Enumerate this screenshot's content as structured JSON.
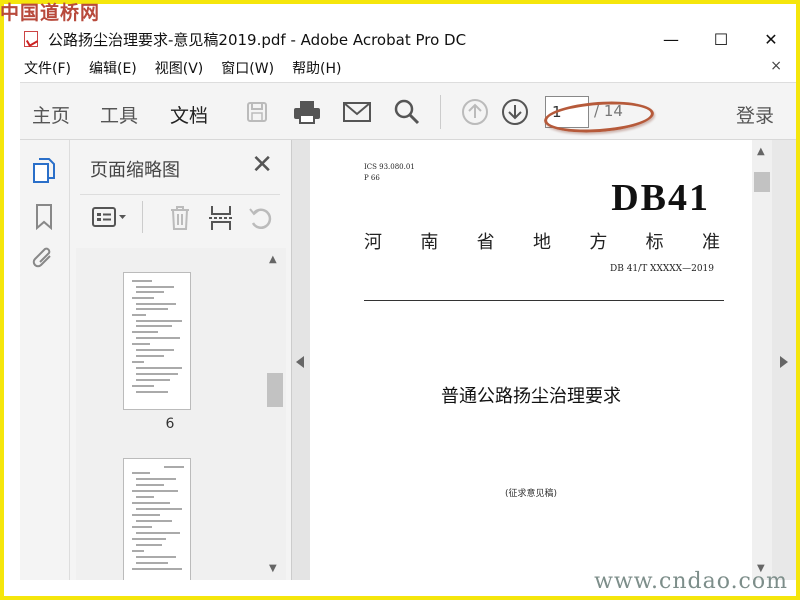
{
  "watermark": {
    "top": "中国道桥网",
    "bottom": "www.cndao.com"
  },
  "window": {
    "title": "公路扬尘治理要求-意见稿2019.pdf - Adobe Acrobat Pro DC"
  },
  "window_buttons": {
    "minimize": "—",
    "maximize": "☐",
    "close": "✕"
  },
  "menu": {
    "items": [
      {
        "label": "文件(F)"
      },
      {
        "label": "编辑(E)"
      },
      {
        "label": "视图(V)"
      },
      {
        "label": "窗口(W)"
      },
      {
        "label": "帮助(H)"
      }
    ],
    "close": "×"
  },
  "toolbar": {
    "tabs": [
      {
        "label": "主页"
      },
      {
        "label": "工具"
      },
      {
        "label": "文档"
      }
    ],
    "active_tab": "文档",
    "page_current": "1",
    "page_total": "/ 14",
    "login": "登录",
    "icons": [
      "save-icon",
      "print-icon",
      "email-icon",
      "search-icon",
      "page-up-icon",
      "page-down-icon"
    ]
  },
  "side_panel": {
    "title": "页面缩略图",
    "close": "✕",
    "thumbnails": [
      {
        "label": "6"
      },
      {
        "label": ""
      }
    ]
  },
  "document": {
    "ics_line": "ICS  93.080.01",
    "p_line": "P    66",
    "code": "DB41",
    "province_chars": [
      "河",
      "南",
      "省",
      "地",
      "方",
      "标",
      "准"
    ],
    "standard_number": "DB 41/T  XXXXX—2019",
    "title": "普通公路扬尘治理要求",
    "draft_note": "(征求意见稿)"
  },
  "colors": {
    "accent_ellipse": "#b65a3a",
    "toolbar_bg": "#f4f4f4",
    "watermark_red": "#b84a3c",
    "frame_yellow": "#f5e60c"
  }
}
